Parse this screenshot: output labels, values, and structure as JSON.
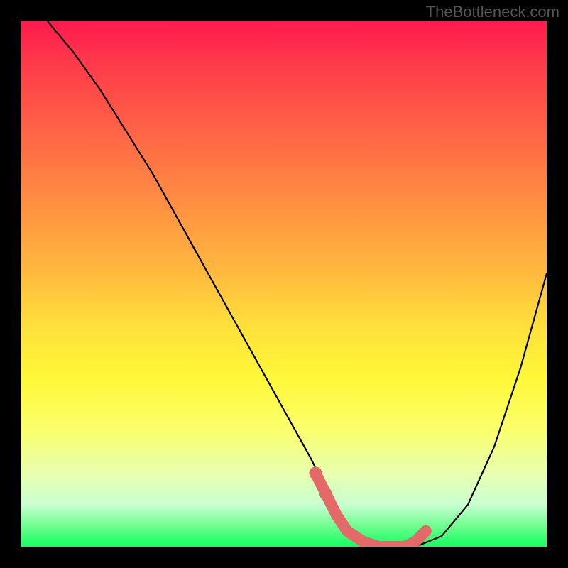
{
  "watermark": "TheBottleneck.com",
  "chart_data": {
    "type": "line",
    "title": "",
    "xlabel": "",
    "ylabel": "",
    "xlim": [
      0,
      100
    ],
    "ylim": [
      0,
      100
    ],
    "series": [
      {
        "name": "bottleneck-curve",
        "x": [
          5,
          10,
          15,
          20,
          25,
          30,
          35,
          40,
          45,
          50,
          55,
          58,
          60,
          62,
          65,
          68,
          70,
          75,
          80,
          85,
          90,
          95,
          100
        ],
        "values": [
          100,
          94,
          87,
          79,
          71,
          62,
          53,
          44,
          35,
          26,
          17,
          11,
          6,
          3,
          1,
          0,
          0,
          0,
          2,
          8,
          19,
          34,
          52
        ]
      },
      {
        "name": "highlight-band",
        "x": [
          56,
          58,
          60,
          62,
          65,
          68,
          70,
          73,
          75,
          77
        ],
        "values": [
          14,
          10,
          6,
          3,
          1,
          0,
          0,
          0,
          1,
          3
        ]
      }
    ]
  }
}
